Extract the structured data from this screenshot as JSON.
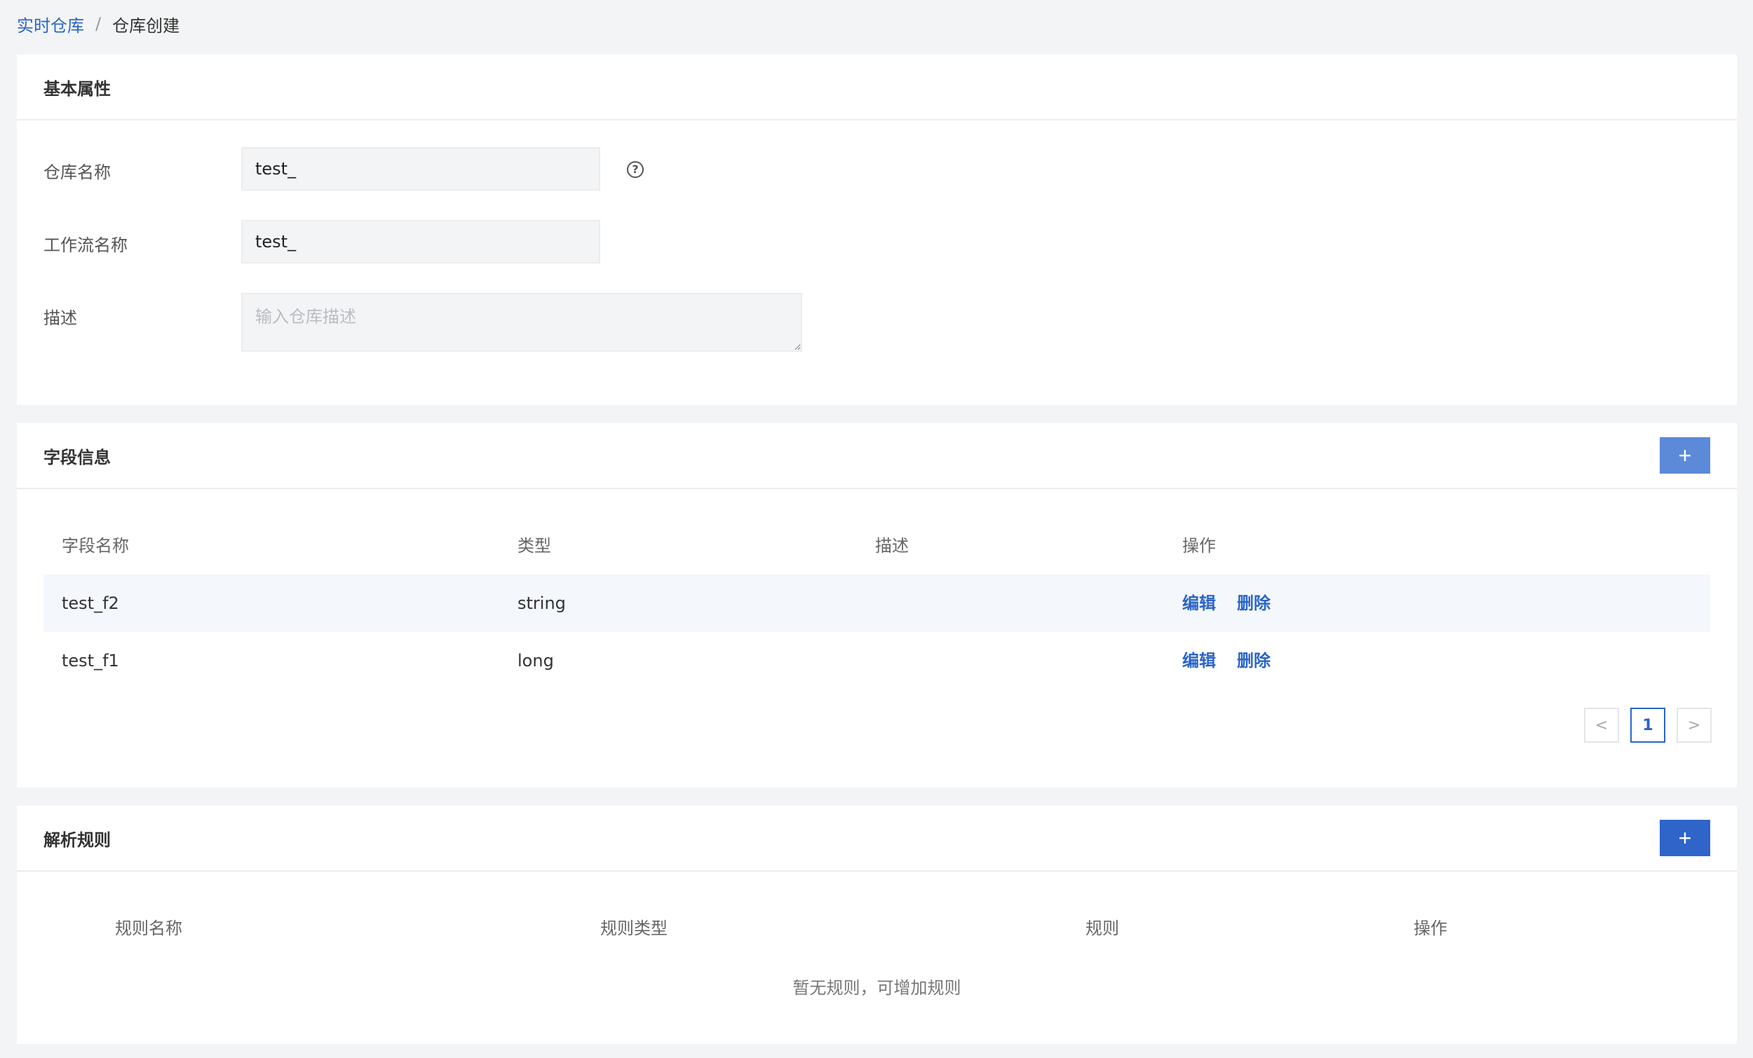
{
  "breadcrumb": {
    "parent": "实时仓库",
    "separator": "/",
    "current": "仓库创建"
  },
  "basic": {
    "title": "基本属性",
    "fields": {
      "warehouse_name": {
        "label": "仓库名称",
        "value": "test_",
        "help_icon": "question-circle-icon"
      },
      "workflow_name": {
        "label": "工作流名称",
        "value": "test_"
      },
      "description": {
        "label": "描述",
        "placeholder": "输入仓库描述",
        "value": ""
      }
    }
  },
  "fields_info": {
    "title": "字段信息",
    "add_label": "+",
    "add_color": "#5c8ad9",
    "columns": [
      "字段名称",
      "类型",
      "描述",
      "操作"
    ],
    "rows": [
      {
        "name": "test_f2",
        "type": "string",
        "desc": "",
        "edit": "编辑",
        "delete": "删除"
      },
      {
        "name": "test_f1",
        "type": "long",
        "desc": "",
        "edit": "编辑",
        "delete": "删除"
      }
    ],
    "pagination": {
      "prev": "<",
      "current": "1",
      "next": ">"
    }
  },
  "parse_rules": {
    "title": "解析规则",
    "add_label": "+",
    "add_color": "#2f64c9",
    "columns": [
      "规则名称",
      "规则类型",
      "规则",
      "操作"
    ],
    "empty_text": "暂无规则，可增加规则"
  }
}
